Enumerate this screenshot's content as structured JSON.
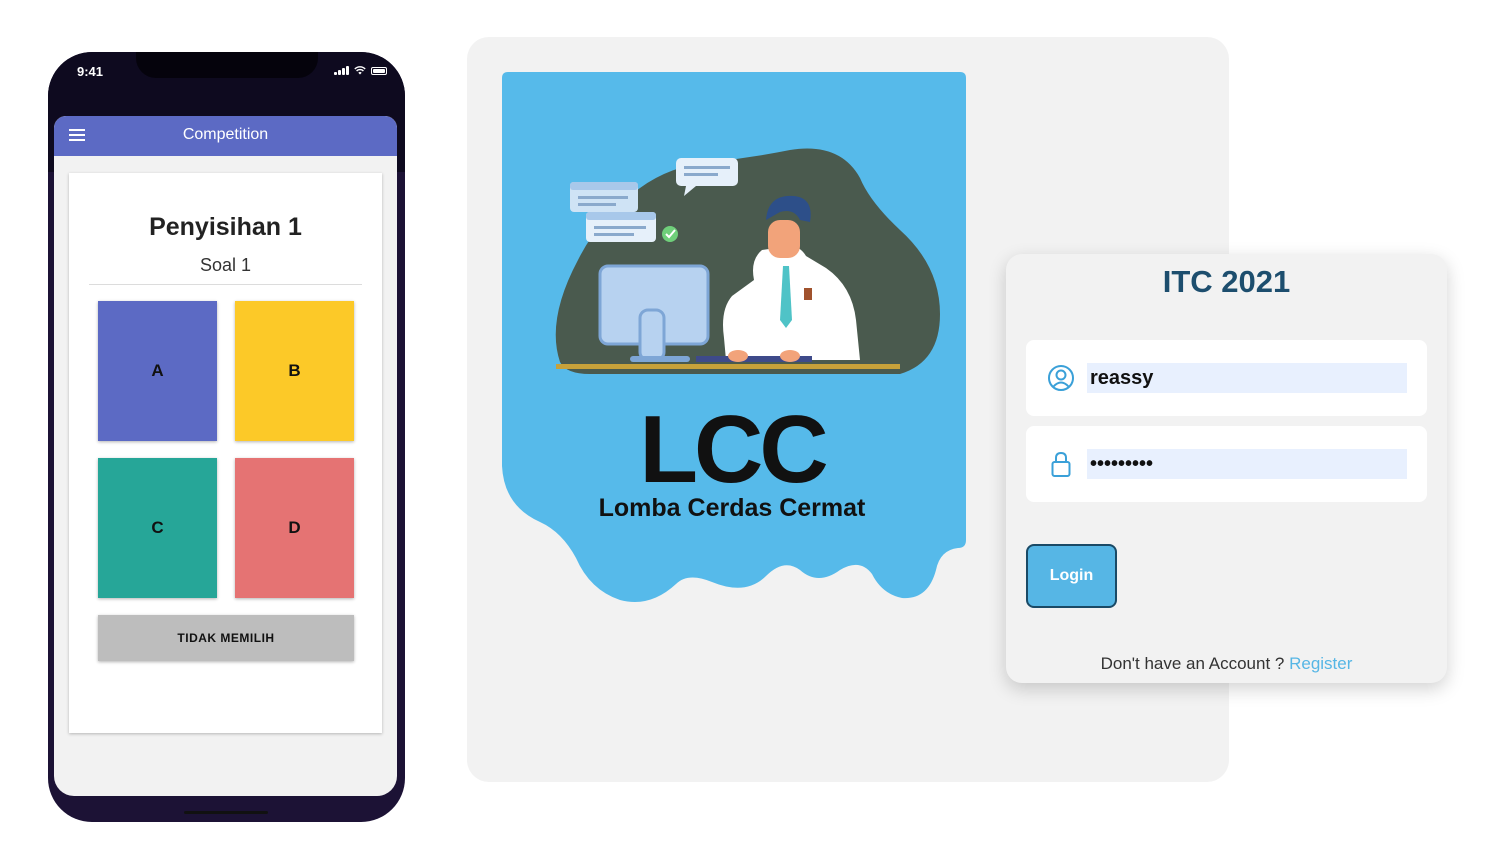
{
  "phone": {
    "status_time": "9:41",
    "appbar_title": "Competition",
    "round_title": "Penyisihan 1",
    "question_label": "Soal 1",
    "options": [
      {
        "label": "A",
        "color": "#5c6ac4"
      },
      {
        "label": "B",
        "color": "#fcc928"
      },
      {
        "label": "C",
        "color": "#26a698"
      },
      {
        "label": "D",
        "color": "#e57373"
      }
    ],
    "skip_label": "TIDAK MEMILIH",
    "appbar_color": "#5c6ac4"
  },
  "logo": {
    "acronym": "LCC",
    "full_name": "Lomba Cerdas Cermat",
    "background_color": "#56baea"
  },
  "login": {
    "title": "ITC 2021",
    "username_value": "reassy",
    "password_value": "•••••••••",
    "username_icon": "user-circle-icon",
    "password_icon": "lock-icon",
    "login_label": "Login",
    "register_prompt": "Don't have an Account ? ",
    "register_link": "Register",
    "accent_color": "#56b6e5"
  }
}
